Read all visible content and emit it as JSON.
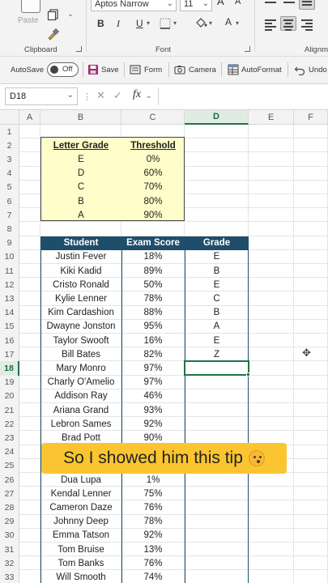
{
  "ribbon": {
    "paste_label": "Paste",
    "font_name": "Aptos Narrow",
    "font_size": "11",
    "bold": "B",
    "italic": "I",
    "underline": "U",
    "increase_font": "A",
    "decrease_font": "A",
    "font_color_letter": "A",
    "clipboard_label": "Clipboard",
    "font_label": "Font",
    "alignment_label": "Alignm"
  },
  "qat": {
    "autosave_label": "AutoSave",
    "autosave_state": "Off",
    "save_label": "Save",
    "form_label": "Form",
    "camera_label": "Camera",
    "autoformat_label": "AutoFormat",
    "undo_label": "Undo"
  },
  "formula_bar": {
    "name_box": "D18",
    "fx": "fx",
    "formula": ""
  },
  "columns": [
    "A",
    "B",
    "C",
    "D",
    "E",
    "F"
  ],
  "selected_column": "D",
  "row_numbers": [
    "1",
    "2",
    "3",
    "4",
    "5",
    "6",
    "7",
    "8",
    "9",
    "10",
    "11",
    "12",
    "13",
    "14",
    "15",
    "16",
    "17",
    "18",
    "19",
    "20",
    "21",
    "22",
    "23",
    "24",
    "25",
    "26",
    "27",
    "28",
    "29",
    "30",
    "31",
    "32",
    "33"
  ],
  "selected_row": "18",
  "threshold_table": {
    "header_grade": "Letter Grade",
    "header_threshold": "Threshold",
    "rows": [
      {
        "grade": "E",
        "threshold": "0%"
      },
      {
        "grade": "D",
        "threshold": "60%"
      },
      {
        "grade": "C",
        "threshold": "70%"
      },
      {
        "grade": "B",
        "threshold": "80%"
      },
      {
        "grade": "A",
        "threshold": "90%"
      }
    ]
  },
  "student_table": {
    "header_student": "Student",
    "header_score": "Exam Score",
    "header_grade": "Grade",
    "rows": [
      {
        "student": "Justin Fever",
        "score": "18%",
        "grade": "E"
      },
      {
        "student": "Kiki Kadid",
        "score": "89%",
        "grade": "B"
      },
      {
        "student": "Cristo Ronald",
        "score": "50%",
        "grade": "E"
      },
      {
        "student": "Kylie Lenner",
        "score": "78%",
        "grade": "C"
      },
      {
        "student": "Kim Cardashion",
        "score": "88%",
        "grade": "B"
      },
      {
        "student": "Dwayne Jonston",
        "score": "95%",
        "grade": "A"
      },
      {
        "student": "Taylor Swooft",
        "score": "16%",
        "grade": "E"
      },
      {
        "student": "Bill Bates",
        "score": "82%",
        "grade": "Z"
      },
      {
        "student": "Mary Monro",
        "score": "97%",
        "grade": ""
      },
      {
        "student": "Charly O'Amelio",
        "score": "97%",
        "grade": ""
      },
      {
        "student": "Addison Ray",
        "score": "46%",
        "grade": ""
      },
      {
        "student": "Ariana Grand",
        "score": "93%",
        "grade": ""
      },
      {
        "student": "Lebron Sames",
        "score": "92%",
        "grade": ""
      },
      {
        "student": "Brad Pott",
        "score": "90%",
        "grade": ""
      },
      {
        "student": "",
        "score": "",
        "grade": ""
      },
      {
        "student": "",
        "score": "",
        "grade": ""
      },
      {
        "student": "Dua Lupa",
        "score": "1%",
        "grade": ""
      },
      {
        "student": "Kendal Lenner",
        "score": "75%",
        "grade": ""
      },
      {
        "student": "Cameron Daze",
        "score": "76%",
        "grade": ""
      },
      {
        "student": "Johnny Deep",
        "score": "78%",
        "grade": ""
      },
      {
        "student": "Emma Tatson",
        "score": "92%",
        "grade": ""
      },
      {
        "student": "Tom Bruise",
        "score": "13%",
        "grade": ""
      },
      {
        "student": "Tom Banks",
        "score": "76%",
        "grade": ""
      },
      {
        "student": "Will Smooth",
        "score": "74%",
        "grade": ""
      }
    ]
  },
  "caption": "So I showed him this tip",
  "colors": {
    "excel_green": "#217346",
    "threshold_fill": "#fffdc9",
    "table_header": "#1f4e6b",
    "caption_bg": "#fbc531"
  }
}
